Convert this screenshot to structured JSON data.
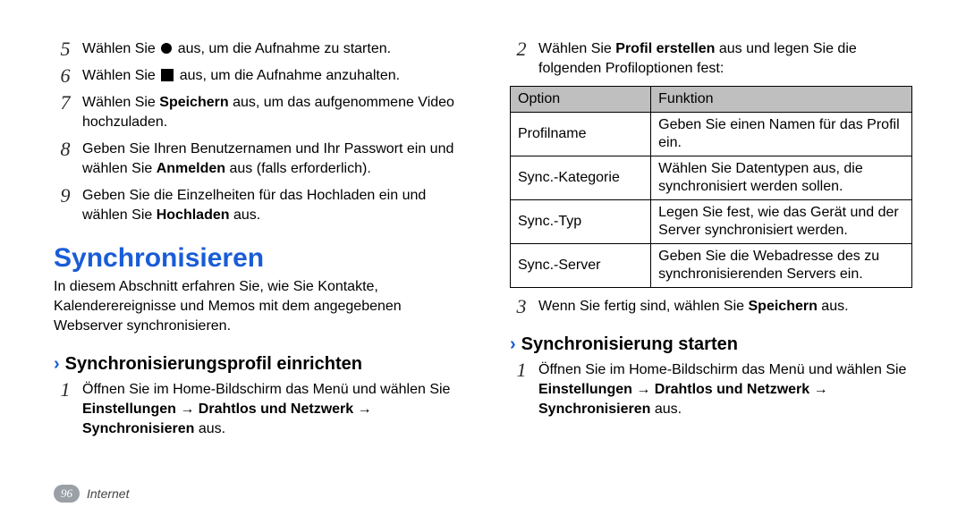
{
  "left": {
    "steps_a": [
      {
        "n": "5",
        "pre": "Wählen Sie ",
        "icon": "dot",
        "post": " aus, um die Aufnahme zu starten."
      },
      {
        "n": "6",
        "pre": "Wählen Sie ",
        "icon": "square",
        "post": " aus, um die Aufnahme anzuhalten."
      }
    ],
    "steps_b": [
      {
        "n": "7",
        "parts": [
          {
            "t": "Wählen Sie "
          },
          {
            "t": "Speichern",
            "b": true
          },
          {
            "t": " aus, um das aufgenommene Video hochzuladen."
          }
        ]
      },
      {
        "n": "8",
        "parts": [
          {
            "t": "Geben Sie Ihren Benutzernamen und Ihr Passwort ein und wählen Sie "
          },
          {
            "t": "Anmelden",
            "b": true
          },
          {
            "t": " aus (falls erforderlich)."
          }
        ]
      },
      {
        "n": "9",
        "parts": [
          {
            "t": "Geben Sie die Einzelheiten für das Hochladen ein und wählen Sie "
          },
          {
            "t": "Hochladen",
            "b": true
          },
          {
            "t": " aus."
          }
        ]
      }
    ],
    "heading": "Synchronisieren",
    "intro": "In diesem Abschnitt erfahren Sie, wie Sie Kontakte, Kalenderereignisse und Memos mit dem angegebenen Webserver synchronisieren.",
    "sub": "Synchronisierungsprofil einrichten",
    "sub_steps": [
      {
        "n": "1",
        "parts": [
          {
            "t": "Öffnen Sie im Home-Bildschirm das Menü und wählen Sie "
          },
          {
            "t": "Einstellungen",
            "b": true
          },
          {
            "t": " → ",
            "a": true
          },
          {
            "t": "Drahtlos und Netzwerk",
            "b": true
          },
          {
            "t": " → ",
            "a": true
          },
          {
            "t": "Synchronisieren",
            "b": true
          },
          {
            "t": " aus."
          }
        ]
      }
    ]
  },
  "right": {
    "top_steps": [
      {
        "n": "2",
        "parts": [
          {
            "t": "Wählen Sie "
          },
          {
            "t": "Profil erstellen",
            "b": true
          },
          {
            "t": " aus und legen Sie die folgenden Profiloptionen fest:"
          }
        ]
      }
    ],
    "table": {
      "head": [
        "Option",
        "Funktion"
      ],
      "rows": [
        [
          "Profilname",
          "Geben Sie einen Namen für das Profil ein."
        ],
        [
          "Sync.-Kategorie",
          "Wählen Sie Datentypen aus, die synchronisiert werden sollen."
        ],
        [
          "Sync.-Typ",
          "Legen Sie fest, wie das Gerät und der Server synchronisiert werden."
        ],
        [
          "Sync.-Server",
          "Geben Sie die Webadresse des zu synchronisierenden Servers ein."
        ]
      ]
    },
    "after_steps": [
      {
        "n": "3",
        "parts": [
          {
            "t": "Wenn Sie fertig sind, wählen Sie "
          },
          {
            "t": "Speichern",
            "b": true
          },
          {
            "t": " aus."
          }
        ]
      }
    ],
    "sub": "Synchronisierung starten",
    "sub_steps": [
      {
        "n": "1",
        "parts": [
          {
            "t": "Öffnen Sie im Home-Bildschirm das Menü und wählen Sie "
          },
          {
            "t": "Einstellungen",
            "b": true
          },
          {
            "t": " → ",
            "a": true
          },
          {
            "t": "Drahtlos und Netzwerk",
            "b": true
          },
          {
            "t": " → ",
            "a": true
          },
          {
            "t": "Synchronisieren",
            "b": true
          },
          {
            "t": " aus."
          }
        ]
      }
    ]
  },
  "footer": {
    "page": "96",
    "section": "Internet"
  },
  "chev": "›"
}
